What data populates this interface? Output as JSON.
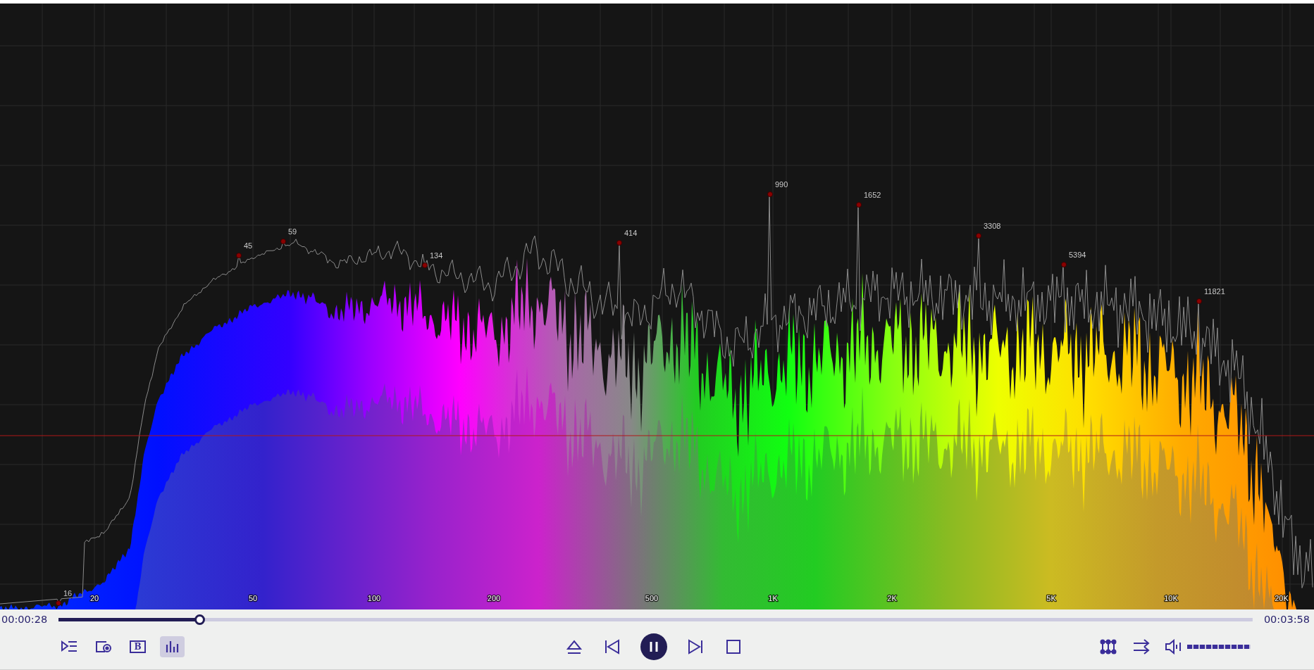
{
  "spectrum": {
    "axis_labels": [
      {
        "label": "20"
      },
      {
        "label": "50"
      },
      {
        "label": "100"
      },
      {
        "label": "200"
      },
      {
        "label": "500"
      },
      {
        "label": "1K"
      },
      {
        "label": "2K"
      },
      {
        "label": "5K"
      },
      {
        "label": "10K"
      },
      {
        "label": "20K"
      }
    ],
    "peaks": [
      {
        "label": "16"
      },
      {
        "label": "45"
      },
      {
        "label": "59"
      },
      {
        "label": "134"
      },
      {
        "label": "414"
      },
      {
        "label": "990"
      },
      {
        "label": "1652"
      },
      {
        "label": "3308"
      },
      {
        "label": "5394"
      },
      {
        "label": "11821"
      }
    ]
  },
  "player": {
    "elapsed": "00:00:28",
    "duration": "00:03:58",
    "progress": {
      "level": 0.118
    },
    "left_tools": [
      {
        "kind": "queue",
        "selected": false
      },
      {
        "kind": "capture",
        "selected": false
      },
      {
        "kind": "subtitle",
        "text": "B",
        "selected": false
      },
      {
        "kind": "visualizer",
        "selected": true
      }
    ],
    "transport": [
      {
        "kind": "eject"
      },
      {
        "kind": "previous"
      },
      {
        "kind": "pause"
      },
      {
        "kind": "next"
      },
      {
        "kind": "stop"
      }
    ],
    "right_tools": [
      {
        "kind": "nodes"
      },
      {
        "kind": "shuffle"
      }
    ],
    "volume": {
      "level": 1
    }
  }
}
